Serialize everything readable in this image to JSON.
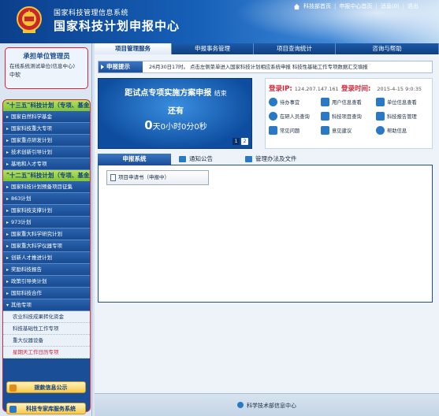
{
  "header": {
    "org_name": "国家科技管理信息系统",
    "center_name": "国家科技计划申报中心",
    "links": [
      "科技部首页",
      "申报中心首页",
      "消息(0)",
      "退出"
    ],
    "accent_color": "#0b3f8c"
  },
  "topnav": {
    "tabs": [
      "项目管理服务",
      "申报事务管理",
      "项目查询统计",
      "咨询与帮助"
    ],
    "active": "项目管理服务"
  },
  "sidebar": {
    "admin_title": "承担单位管理员",
    "admin_unit": "在线系统测试单位(信息中心)",
    "admin_role": "中软",
    "sections": [
      {
        "head": "\"十三五\"科技计划（专项、基金）",
        "items": [
          "国家自然科学基金",
          "国家科技重大专项",
          "国家重点研发计划",
          "技术创新引导计划",
          "基地和人才专项"
        ]
      },
      {
        "head": "\"十二五\"科技计划（专项、基金）",
        "items": [
          "国家科技计划预备项目征集",
          "863计划",
          "国家科技支撑计划",
          "973计划",
          "国家重大科学研究计划",
          "国家重大科学仪器专项",
          "创新人才推进计划",
          "奖励科技报告",
          "政策引导类计划",
          "国际科技合作",
          "其他专项"
        ]
      },
      {
        "head": "",
        "subitems": [
          "农业科技成果转化资金",
          "科技基础性工作专项",
          "重大仪器设备",
          "星期天工作日历专项"
        ]
      }
    ],
    "btn_finance": "拨款信息公示",
    "btn_expert": "科技专家库服务系统"
  },
  "notice": {
    "label": "申报提示",
    "text": "26月30日17时。   点击左侧菜单进入国家科技计划相应系统申报      科技性基础工作专项数据汇交填报"
  },
  "countdown": {
    "title": "距试点专项实施方案申报",
    "title_suffix": "结束",
    "sub": "还有",
    "days": "0",
    "rest": "天0小时0分0秒",
    "pages": [
      "1",
      "2"
    ]
  },
  "login": {
    "ip_label": "登录IP:",
    "ip_value": "124.207.147.161",
    "time_label": "登录时间:",
    "time_value": "2015-4-15 9:0:35",
    "quick_items": [
      "待办事宜",
      "用户信息查看",
      "单位信息查看",
      "在研人员查询",
      "科技项目查询",
      "科技报告管理",
      "常见问题",
      "意见建议",
      "帮助信息"
    ]
  },
  "content_tabs": {
    "tabs": [
      "申报系统",
      "通知公告",
      "管理办法及文件"
    ],
    "active": "申报系统",
    "app_button": "项目申请书（申报中）"
  },
  "footer": {
    "text": "科学技术部信息中心"
  }
}
